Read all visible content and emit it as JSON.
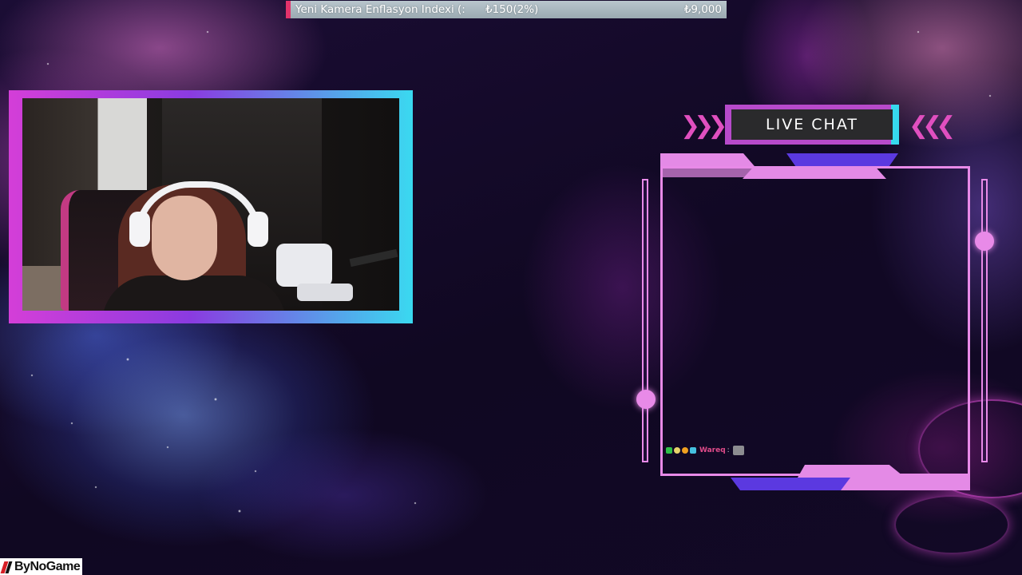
{
  "ticker": {
    "label": "Yeni Kamera Enflasyon Indexi (:",
    "change": "₺150(2%)",
    "price": "₺9,000",
    "accent_color": "#e2336b"
  },
  "webcam": {
    "frame_colors": [
      "#d43ed8",
      "#8a3be0",
      "#3ad9f0"
    ]
  },
  "live_chat": {
    "title": "LIVE CHAT",
    "accent_pink": "#e88ae8",
    "accent_blue": "#5b39e0",
    "accent_cyan": "#36d9ee",
    "messages": [
      {
        "username": "Wareq",
        "separator": ":",
        "badges": [
          "badge-icon",
          "moon-icon",
          "info-badge-icon",
          "grid-badge-icon"
        ],
        "emote": "cat-emote-icon"
      }
    ]
  },
  "branding": {
    "logo_text": "ByNoGame"
  }
}
